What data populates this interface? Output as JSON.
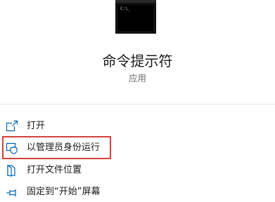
{
  "app": {
    "title": "命令提示符",
    "subtitle": "应用",
    "icon": "command-prompt-icon"
  },
  "menu": {
    "items": [
      {
        "label": "打开",
        "icon": "open-icon"
      },
      {
        "label": "以管理员身份运行",
        "icon": "run-as-admin-shield-icon"
      },
      {
        "label": "打开文件位置",
        "icon": "file-location-icon"
      },
      {
        "label": "固定到“开始”屏幕",
        "icon": "pin-icon"
      }
    ]
  },
  "colors": {
    "accent": "#0063b1",
    "highlight_border": "#d6403b",
    "subtitle": "#6b6b6b"
  }
}
